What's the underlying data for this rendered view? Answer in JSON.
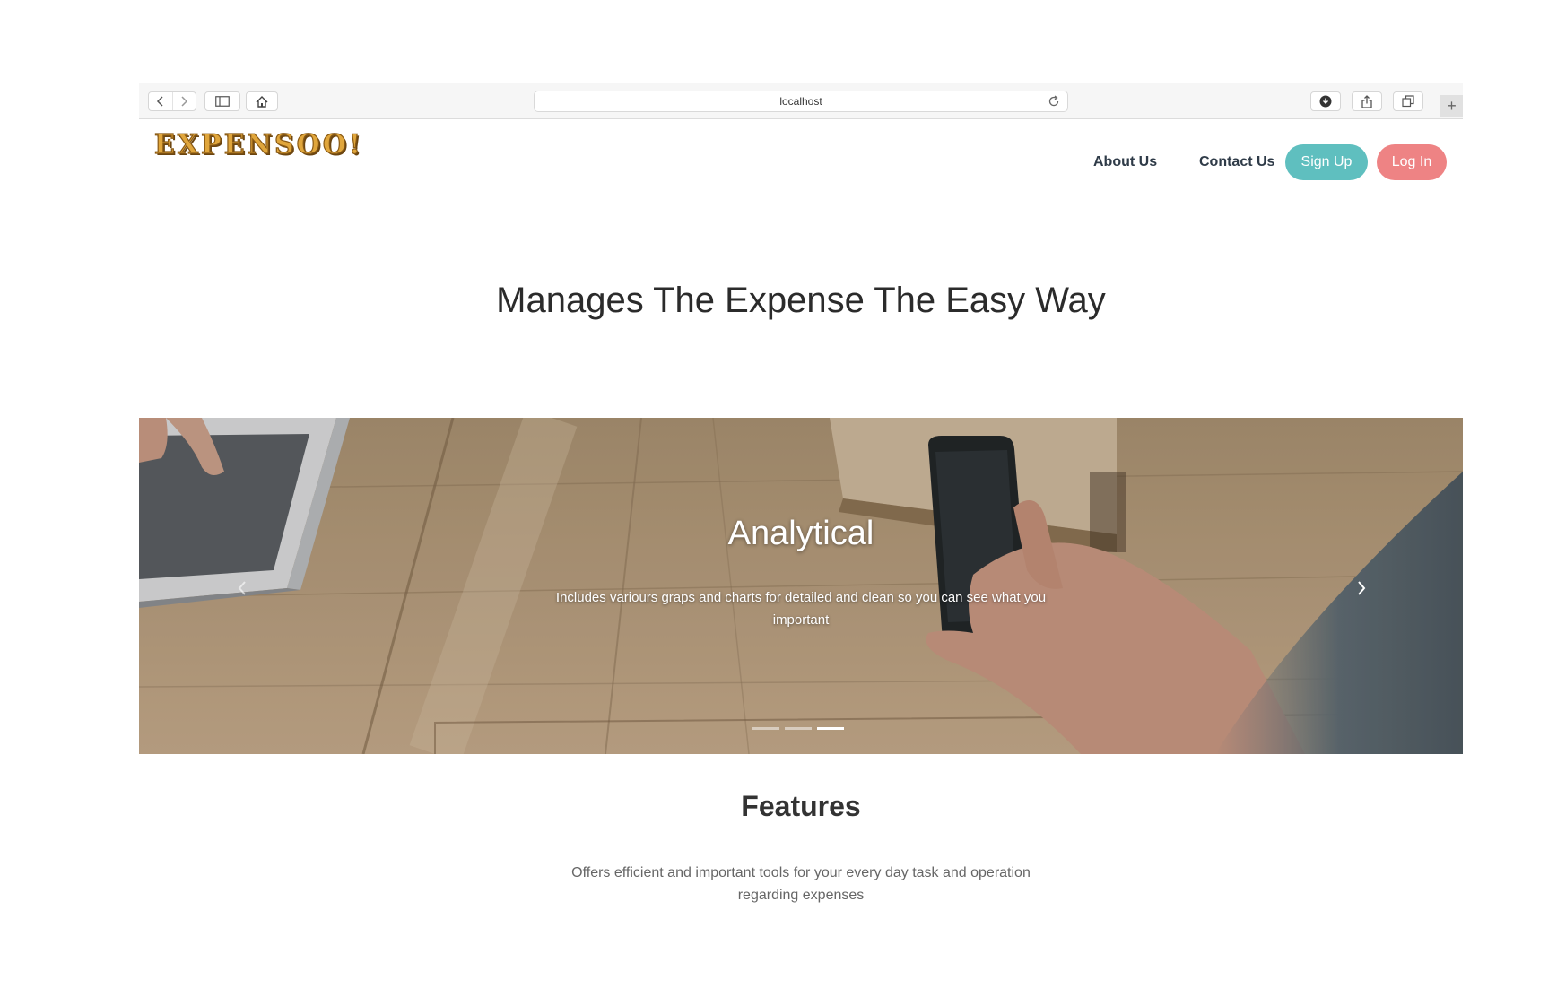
{
  "browser": {
    "address": "localhost"
  },
  "site": {
    "logo": "EXPENSOO!",
    "nav": {
      "about": "About Us",
      "contact": "Contact Us",
      "signup": "Sign Up",
      "login": "Log In"
    },
    "hero": {
      "title": "Manages The Expense The Easy Way"
    },
    "carousel": {
      "slide_title": "Analytical",
      "slide_text": "Includes variours graps and charts for detailed and clean so you can see what you important",
      "slide_count": 3,
      "active_index": 2
    },
    "features": {
      "title": "Features",
      "text": "Offers efficient and important tools for your every day task and operation regarding expenses"
    }
  },
  "colors": {
    "logo": "#e0a63c",
    "signup_button": "#5fbfbf",
    "login_button": "#ee8384",
    "nav_text": "#2f3b48"
  },
  "icons": [
    "back-icon",
    "forward-icon",
    "sidebar-icon",
    "home-icon",
    "reload-icon",
    "download-icon",
    "share-icon",
    "tabs-icon",
    "plus-icon",
    "chevron-left-icon",
    "chevron-right-icon"
  ]
}
